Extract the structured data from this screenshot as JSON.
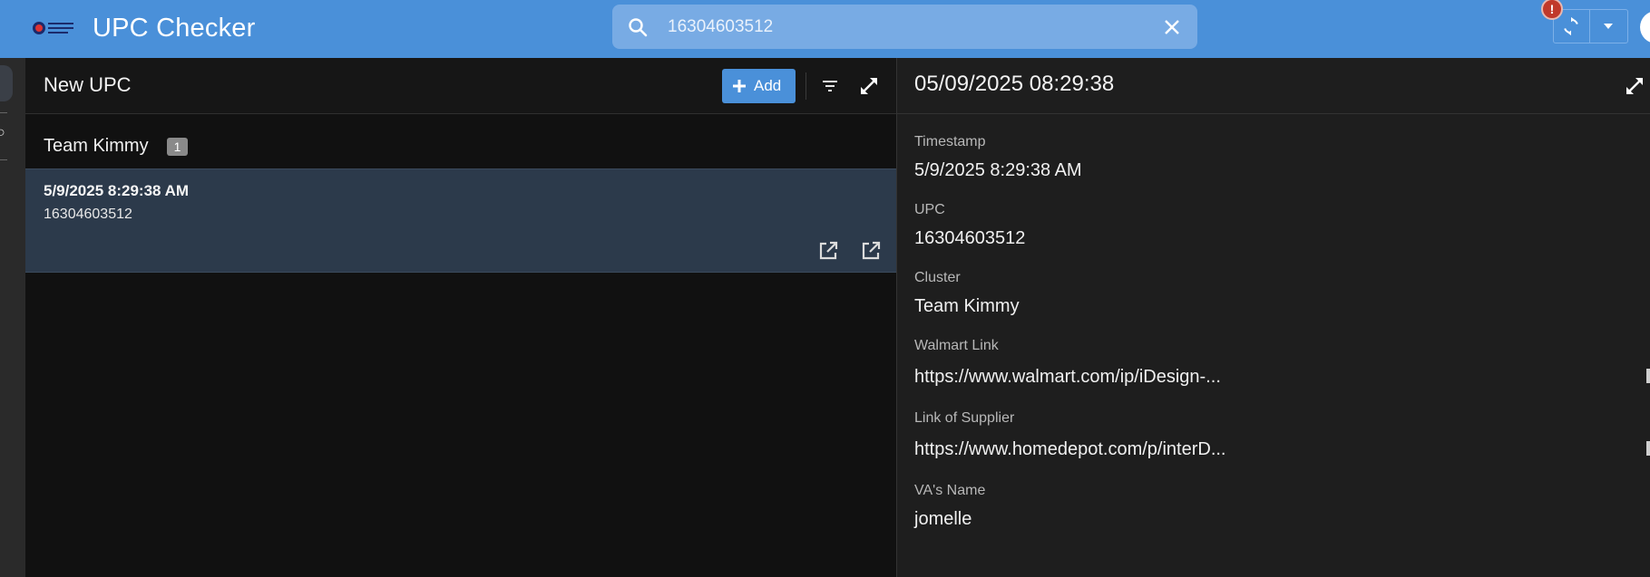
{
  "header": {
    "app_title": "UPC Checker",
    "search_value": "16304603512",
    "alert_badge": "!"
  },
  "list_panel": {
    "title": "New UPC",
    "add_label": "Add",
    "group": {
      "name": "Team Kimmy",
      "count": "1"
    },
    "record": {
      "timestamp": "5/9/2025 8:29:38 AM",
      "upc": "16304603512"
    }
  },
  "detail_panel": {
    "title": "05/09/2025 08:29:38",
    "fields": [
      {
        "label": "Timestamp",
        "value": "5/9/2025 8:29:38 AM"
      },
      {
        "label": "UPC",
        "value": "16304603512"
      },
      {
        "label": "Cluster",
        "value": "Team Kimmy"
      },
      {
        "label": "Walmart Link",
        "value": "https://www.walmart.com/ip/iDesign-..."
      },
      {
        "label": "Link of Supplier",
        "value": "https://www.homedepot.com/p/interD..."
      },
      {
        "label": "VA's Name",
        "value": "jomelle"
      }
    ]
  },
  "icons": {
    "logo": "brand-logo",
    "search": "search-icon",
    "clear": "close-icon",
    "sync": "sync-icon",
    "dropdown": "chevron-down-icon",
    "filter": "filter-icon",
    "expand": "expand-icon",
    "open": "open-in-new-icon"
  },
  "colors": {
    "accent": "#4a90d9",
    "selected_row": "#2c3a4b",
    "alert": "#c0392b"
  }
}
